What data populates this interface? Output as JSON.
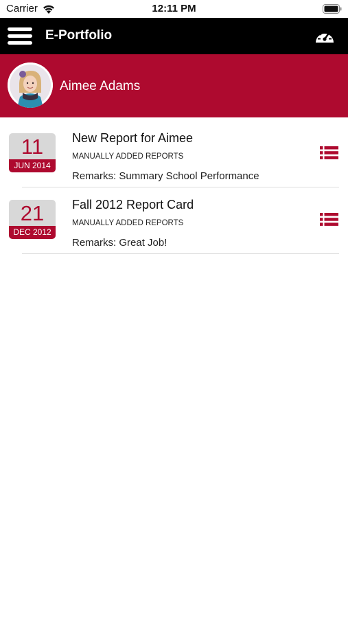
{
  "status_bar": {
    "carrier": "Carrier",
    "time": "12:11 PM"
  },
  "nav": {
    "title": "E-Portfolio",
    "menu_icon": "hamburger-menu-icon",
    "right_icon": "dashboard-speedometer-icon"
  },
  "profile": {
    "name": "Aimee Adams"
  },
  "reports": [
    {
      "day": "11",
      "month_year": "JUN 2014",
      "title": "New Report for Aimee",
      "category": "MANUALLY ADDED REPORTS",
      "remarks": "Remarks: Summary School Performance",
      "icon": "list-icon"
    },
    {
      "day": "21",
      "month_year": "DEC 2012",
      "title": "Fall 2012 Report Card",
      "category": "MANUALLY ADDED REPORTS",
      "remarks": "Remarks: Great Job!",
      "icon": "list-icon"
    }
  ],
  "colors": {
    "brand_red": "#ae0a2f",
    "nav_black": "#000000",
    "calendar_gray": "#d8d8d8"
  }
}
